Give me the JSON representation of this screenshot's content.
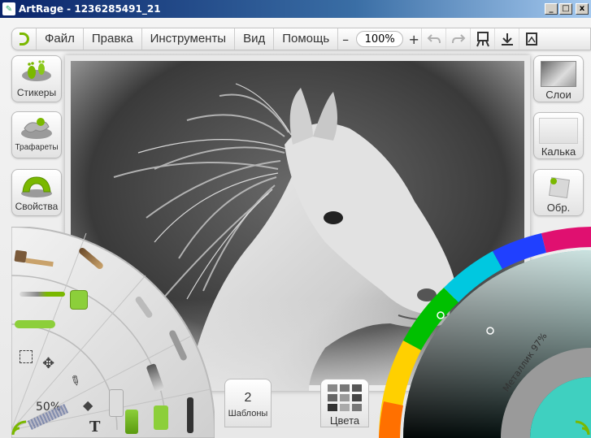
{
  "window": {
    "title": "ArtRage - 1236285491_21",
    "controls": [
      "_",
      "□",
      "x"
    ]
  },
  "menu": {
    "items": [
      "Файл",
      "Правка",
      "Инструменты",
      "Вид",
      "Помощь"
    ],
    "zoom_minus": "–",
    "zoom_value": "100%",
    "zoom_plus": "+"
  },
  "left_panels": [
    {
      "label": "Стикеры",
      "icon": "footprints-icon"
    },
    {
      "label": "Трафареты",
      "icon": "stencils-icon"
    },
    {
      "label": "Свойства",
      "icon": "properties-icon"
    }
  ],
  "right_panels": [
    {
      "label": "Слои",
      "icon": "layer-thumbnail"
    },
    {
      "label": "Калька",
      "icon": "tracing-icon"
    },
    {
      "label": "Обр.",
      "icon": "reference-pin-icon"
    }
  ],
  "tools": {
    "brush_size": "50%",
    "icons": [
      "oil-brush-icon",
      "watercolor-icon",
      "pencil-icon",
      "crayon-icon",
      "palette-knife-icon",
      "airbrush-icon",
      "marker-icon",
      "paint-tube-icon",
      "glitter-icon",
      "ink-pen-icon",
      "select-icon",
      "transform-icon",
      "eyedropper-icon",
      "fill-icon",
      "text-icon"
    ]
  },
  "presets": {
    "count": "2",
    "label": "Шаблоны"
  },
  "swatches": {
    "label": "Цвета"
  },
  "color": {
    "metallic": "Металлик 97%",
    "accent": "#3fd0c0"
  }
}
